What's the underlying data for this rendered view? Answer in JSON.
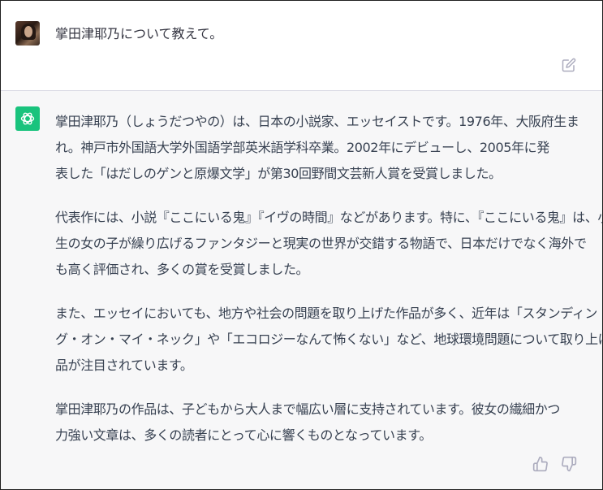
{
  "user_message": {
    "text": "掌田津耶乃について教えて。"
  },
  "assistant_message": {
    "paragraphs": [
      [
        "掌田津耶乃（しょうだつやの）は、日本の小説家、エッセイストです。1976年、大阪府生ま",
        "れ。神戸市外国語大学外国語学部英米語学科卒業。2002年にデビューし、2005年に発",
        "表した「はだしのゲンと原爆文学」が第30回野間文芸新人賞を受賞しました。"
      ],
      [
        "代表作には、小説『ここにいる鬼』『イヴの時間』などがあります。特に、『ここにいる鬼』は、小学",
        "生の女の子が繰り広げるファンタジーと現実の世界が交錯する物語で、日本だけでなく海外で",
        "も高く評価され、多くの賞を受賞しました。"
      ],
      [
        "また、エッセイにおいても、地方や社会の問題を取り上げた作品が多く、近年は「スタンディン",
        "グ・オン・マイ・ネック」や「エコロジーなんて怖くない」など、地球環境問題について取り上げた作",
        "品が注目されています。"
      ],
      [
        "掌田津耶乃の作品は、子どもから大人まで幅広い層に支持されています。彼女の繊細かつ",
        "力強い文章は、多くの読者にとって心に響くものとなっています。"
      ]
    ]
  },
  "icons": {
    "user_avatar": "user-avatar-photo",
    "assistant_avatar": "openai-logo-icon",
    "edit": "edit-icon",
    "thumbs_up": "thumbs-up-icon",
    "thumbs_down": "thumbs-down-icon"
  },
  "colors": {
    "assistant_bg": "#f7f7f8",
    "logo_bg": "#19c37d",
    "text": "#374151",
    "icon": "#acacbe"
  }
}
